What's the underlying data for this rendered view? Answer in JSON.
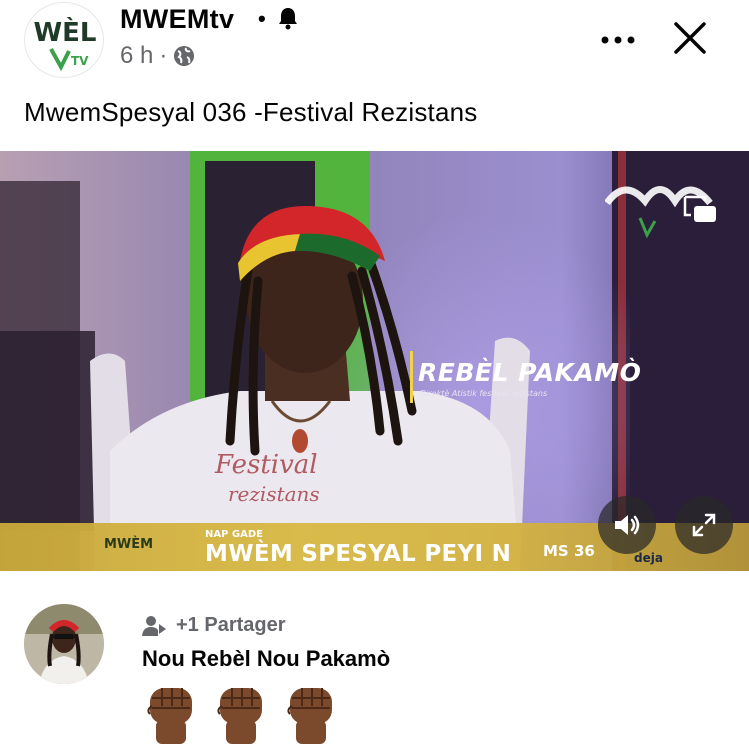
{
  "header": {
    "page_name": "MWEMtv",
    "separator": "•",
    "time": "6 h",
    "meta_dot": "·",
    "avatar_logo_text": "WÈL",
    "avatar_logo_sub": "TV",
    "icons": {
      "bell": "bell-icon",
      "globe": "globe-icon",
      "more": "more-horizontal-icon",
      "close": "close-icon"
    }
  },
  "post": {
    "title": "MwemSpesyal 036 -Festival Rezistans"
  },
  "video": {
    "guest_name": "REBÈL PAKAMÒ",
    "guest_role": "Direktè Atistik festival rezistans",
    "lower_tag": "NAP GADE",
    "show_title": "MWÈM SPESYAL PEYI N",
    "episode": "MS 36",
    "lower_logo": "MWÈM",
    "sponsor": "deja",
    "shirt_line1": "Festival",
    "shirt_line2": "rezistans",
    "controls": {
      "volume": "volume-icon",
      "expand": "expand-icon",
      "pip": "picture-in-picture-icon"
    },
    "colors": {
      "lower_third": "#d4b340",
      "wall": "#7f6fa0",
      "door_frame": "#52b43c"
    }
  },
  "comment": {
    "share_label": "+1 Partager",
    "text": "Nou Rebèl Nou Pakamò",
    "emoji": "✊🏾✊🏾✊🏾",
    "icons": {
      "share": "share-person-icon",
      "fist": "raised-fist-icon"
    }
  }
}
